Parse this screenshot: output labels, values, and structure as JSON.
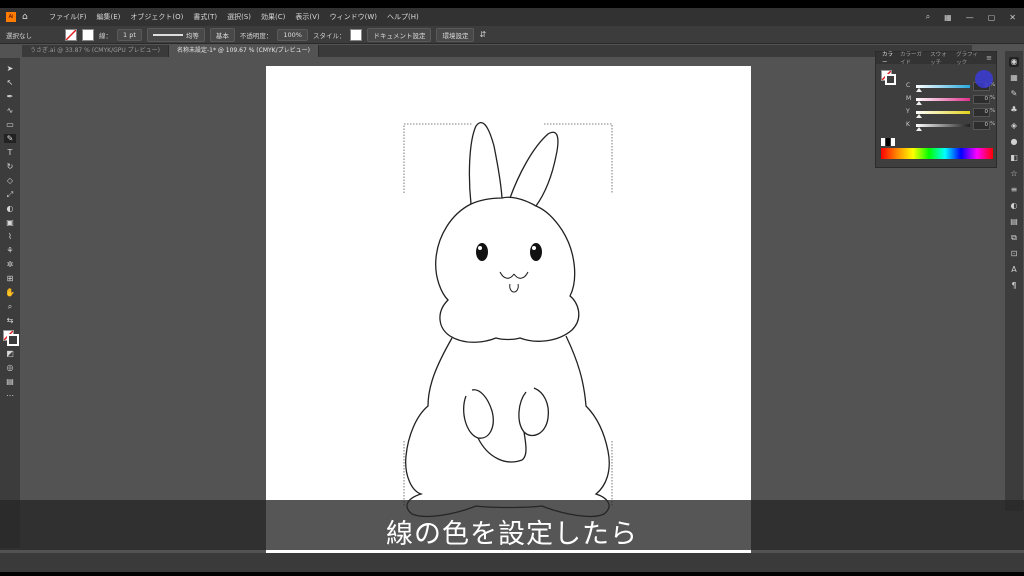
{
  "menu": {
    "items": [
      "ファイル(F)",
      "編集(E)",
      "オブジェクト(O)",
      "書式(T)",
      "選択(S)",
      "効果(C)",
      "表示(V)",
      "ウィンドウ(W)",
      "ヘルプ(H)"
    ]
  },
  "control": {
    "selection": "選択なし",
    "stroke_label": "線：",
    "stroke_weight": "1 pt",
    "profile": "均等",
    "brush": "基本",
    "opacity_label": "不透明度：",
    "opacity_value": "100%",
    "style_label": "スタイル：",
    "doc_settings": "ドキュメント設定",
    "preferences": "環境設定"
  },
  "tabs": [
    {
      "label": "うさぎ.ai @ 33.87 % (CMYK/GPU プレビュー)"
    },
    {
      "label": "名称未設定-1* @ 109.67 % (CMYK/プレビュー)"
    }
  ],
  "color_panel": {
    "tabs": [
      "カラー",
      "カラーガイド",
      "スウォッチ",
      "グラフィック"
    ],
    "sliders": [
      {
        "label": "C",
        "value": "0",
        "color": "#29a8df"
      },
      {
        "label": "M",
        "value": "0",
        "color": "#e0318c"
      },
      {
        "label": "Y",
        "value": "0",
        "color": "#e3d21c"
      },
      {
        "label": "K",
        "value": "0",
        "color": "#222222"
      }
    ],
    "percent": "%",
    "highlight_color": "#3b3bd8"
  },
  "subtitle": "線の色を設定したら"
}
